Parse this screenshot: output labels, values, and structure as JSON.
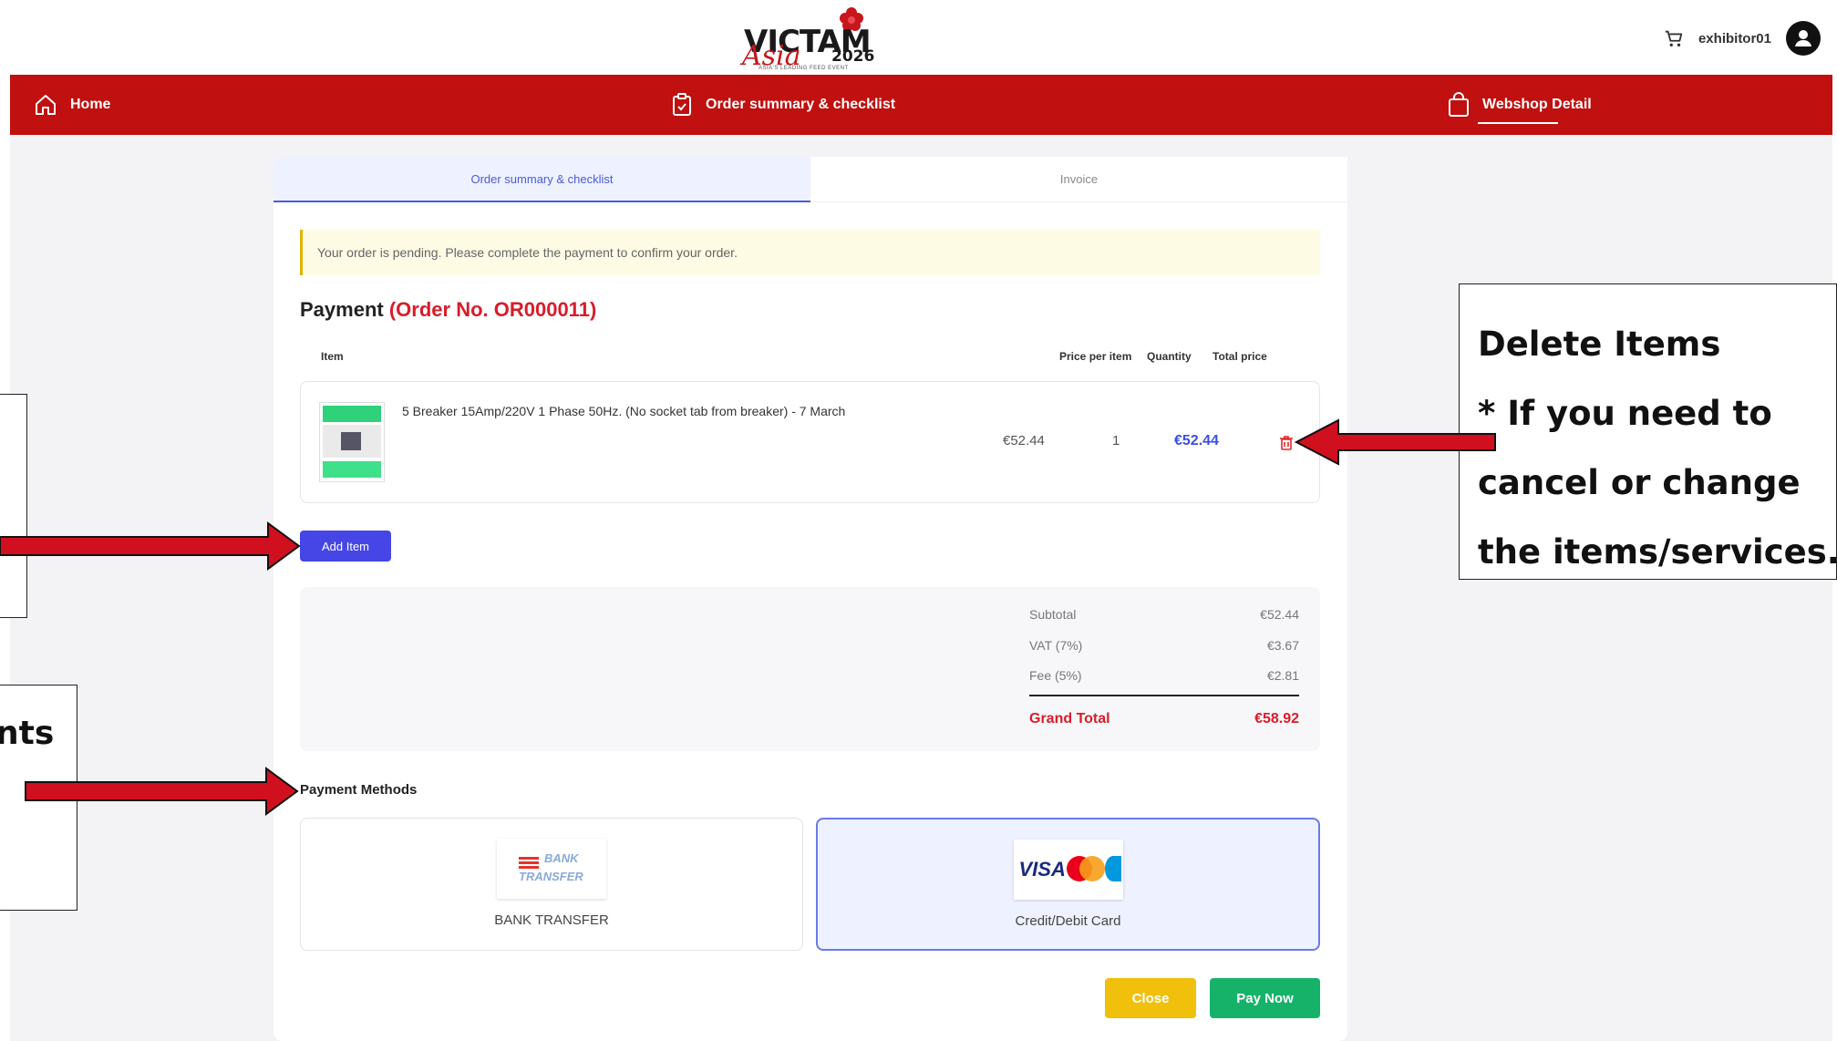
{
  "header": {
    "logo": {
      "main": "VICTAM",
      "script": "Asia",
      "year": "2026",
      "sub": "ASIA'S LEADING FEED EVENT"
    },
    "user_name": "exhibitor01"
  },
  "nav": {
    "home": "Home",
    "order_summary": "Order summary & checklist",
    "webshop_detail": "Webshop Detail"
  },
  "tabs": {
    "order_summary": "Order summary & checklist",
    "invoice": "Invoice"
  },
  "alert": "Your order is pending. Please complete the payment to confirm your order.",
  "payment": {
    "title": "Payment",
    "order_no": "(Order No. OR000011)"
  },
  "columns": {
    "item": "Item",
    "price_per_item": "Price per item",
    "quantity": "Quantity",
    "total_price": "Total price"
  },
  "items": [
    {
      "name": "5 Breaker 15Amp/220V 1 Phase 50Hz. (No socket tab from breaker) - 7 March",
      "price": "€52.44",
      "quantity": "1",
      "total": "€52.44"
    }
  ],
  "add_item": "Add Item",
  "totals": {
    "subtotal_label": "Subtotal",
    "subtotal": "€52.44",
    "vat_label": "VAT (7%)",
    "vat": "€3.67",
    "fee_label": "Fee (5%)",
    "fee": "€2.81",
    "grand_label": "Grand Total",
    "grand": "€58.92"
  },
  "payment_methods": {
    "label": "Payment Methods",
    "bank": {
      "name": "BANK TRANSFER",
      "logo_top": "BANK",
      "logo_bottom": "TRANSFER"
    },
    "credit": {
      "name": "Credit/Debit Card",
      "logo": "VISA"
    }
  },
  "buttons": {
    "close": "Close",
    "pay_now": "Pay Now"
  },
  "annotations": {
    "right_lines": [
      "Delete Items",
      "* If you need to",
      "cancel or change",
      "the items/services."
    ],
    "left_fragment": "nts"
  },
  "colors": {
    "brand_red": "#c01010",
    "accent_blue": "#4646e6",
    "pay_green": "#16b26a",
    "close_yellow": "#f0c00c",
    "arrow_red": "#d0101e"
  }
}
